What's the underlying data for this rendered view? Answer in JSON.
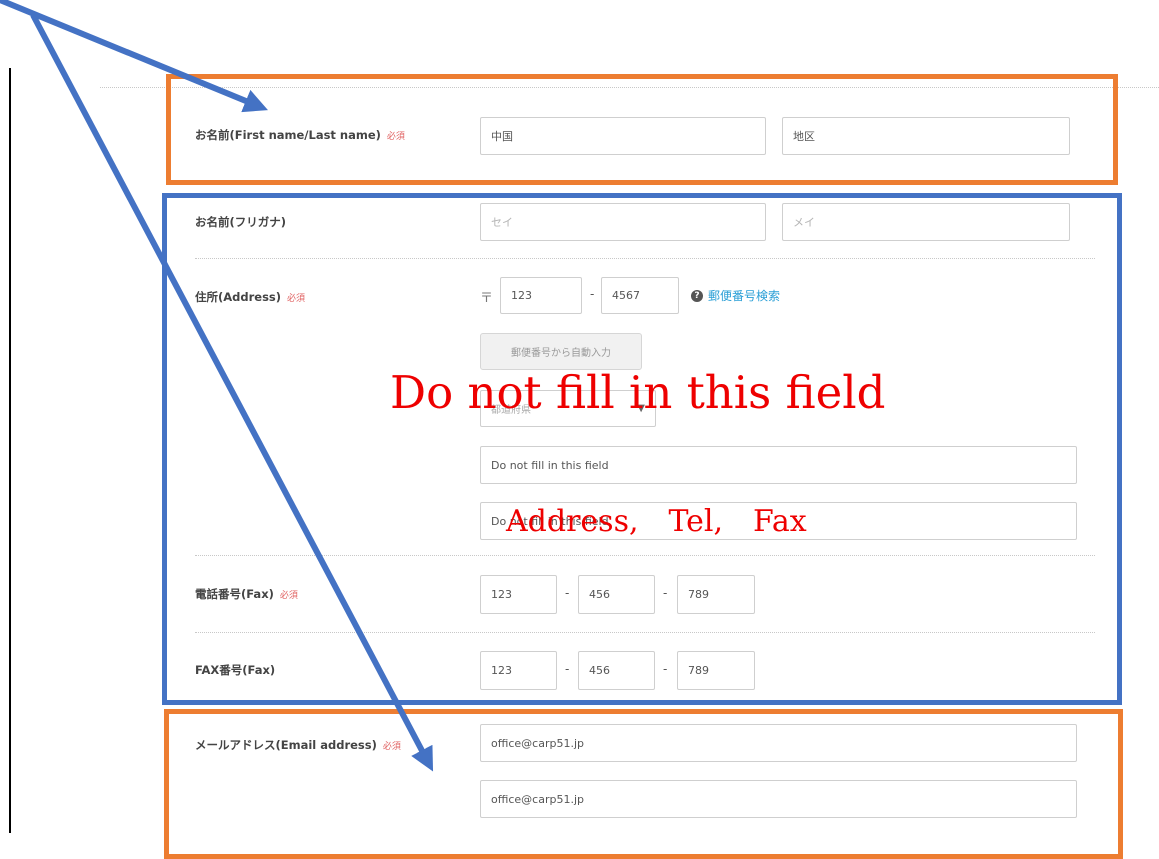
{
  "form": {
    "name": {
      "label": "お名前(First name/Last name)",
      "required": "必須",
      "last_value": "中国",
      "first_value": "地区"
    },
    "kana": {
      "label": "お名前(フリガナ)",
      "last_placeholder": "セイ",
      "first_placeholder": "メイ"
    },
    "address": {
      "label": "住所(Address)",
      "required": "必須",
      "postal_mark": "〒",
      "zip1": "123",
      "zip2": "4567",
      "help_icon": "?",
      "zip_search_link": "郵便番号検索",
      "autofill_button": "郵便番号から自動入力",
      "prefecture_select": "都道府県",
      "line1": "Do not fill in this field",
      "line2": "Do not fill in this field"
    },
    "tel": {
      "label": "電話番号(Fax)",
      "required": "必須",
      "part1": "123",
      "part2": "456",
      "part3": "789"
    },
    "fax": {
      "label": "FAX番号(Fax)",
      "part1": "123",
      "part2": "456",
      "part3": "789"
    },
    "email": {
      "label": "メールアドレス(Email address)",
      "required": "必須",
      "value": "office@carp51.jp",
      "confirm_value": "office@carp51.jp"
    },
    "dash": "-"
  },
  "annotations": {
    "main_note": "Do not fill in this field",
    "sub_note": "Address,　Tel,　Fax",
    "orange_color": "#ed7d31",
    "blue_color": "#4472c4",
    "text_color": "#ee0000"
  }
}
